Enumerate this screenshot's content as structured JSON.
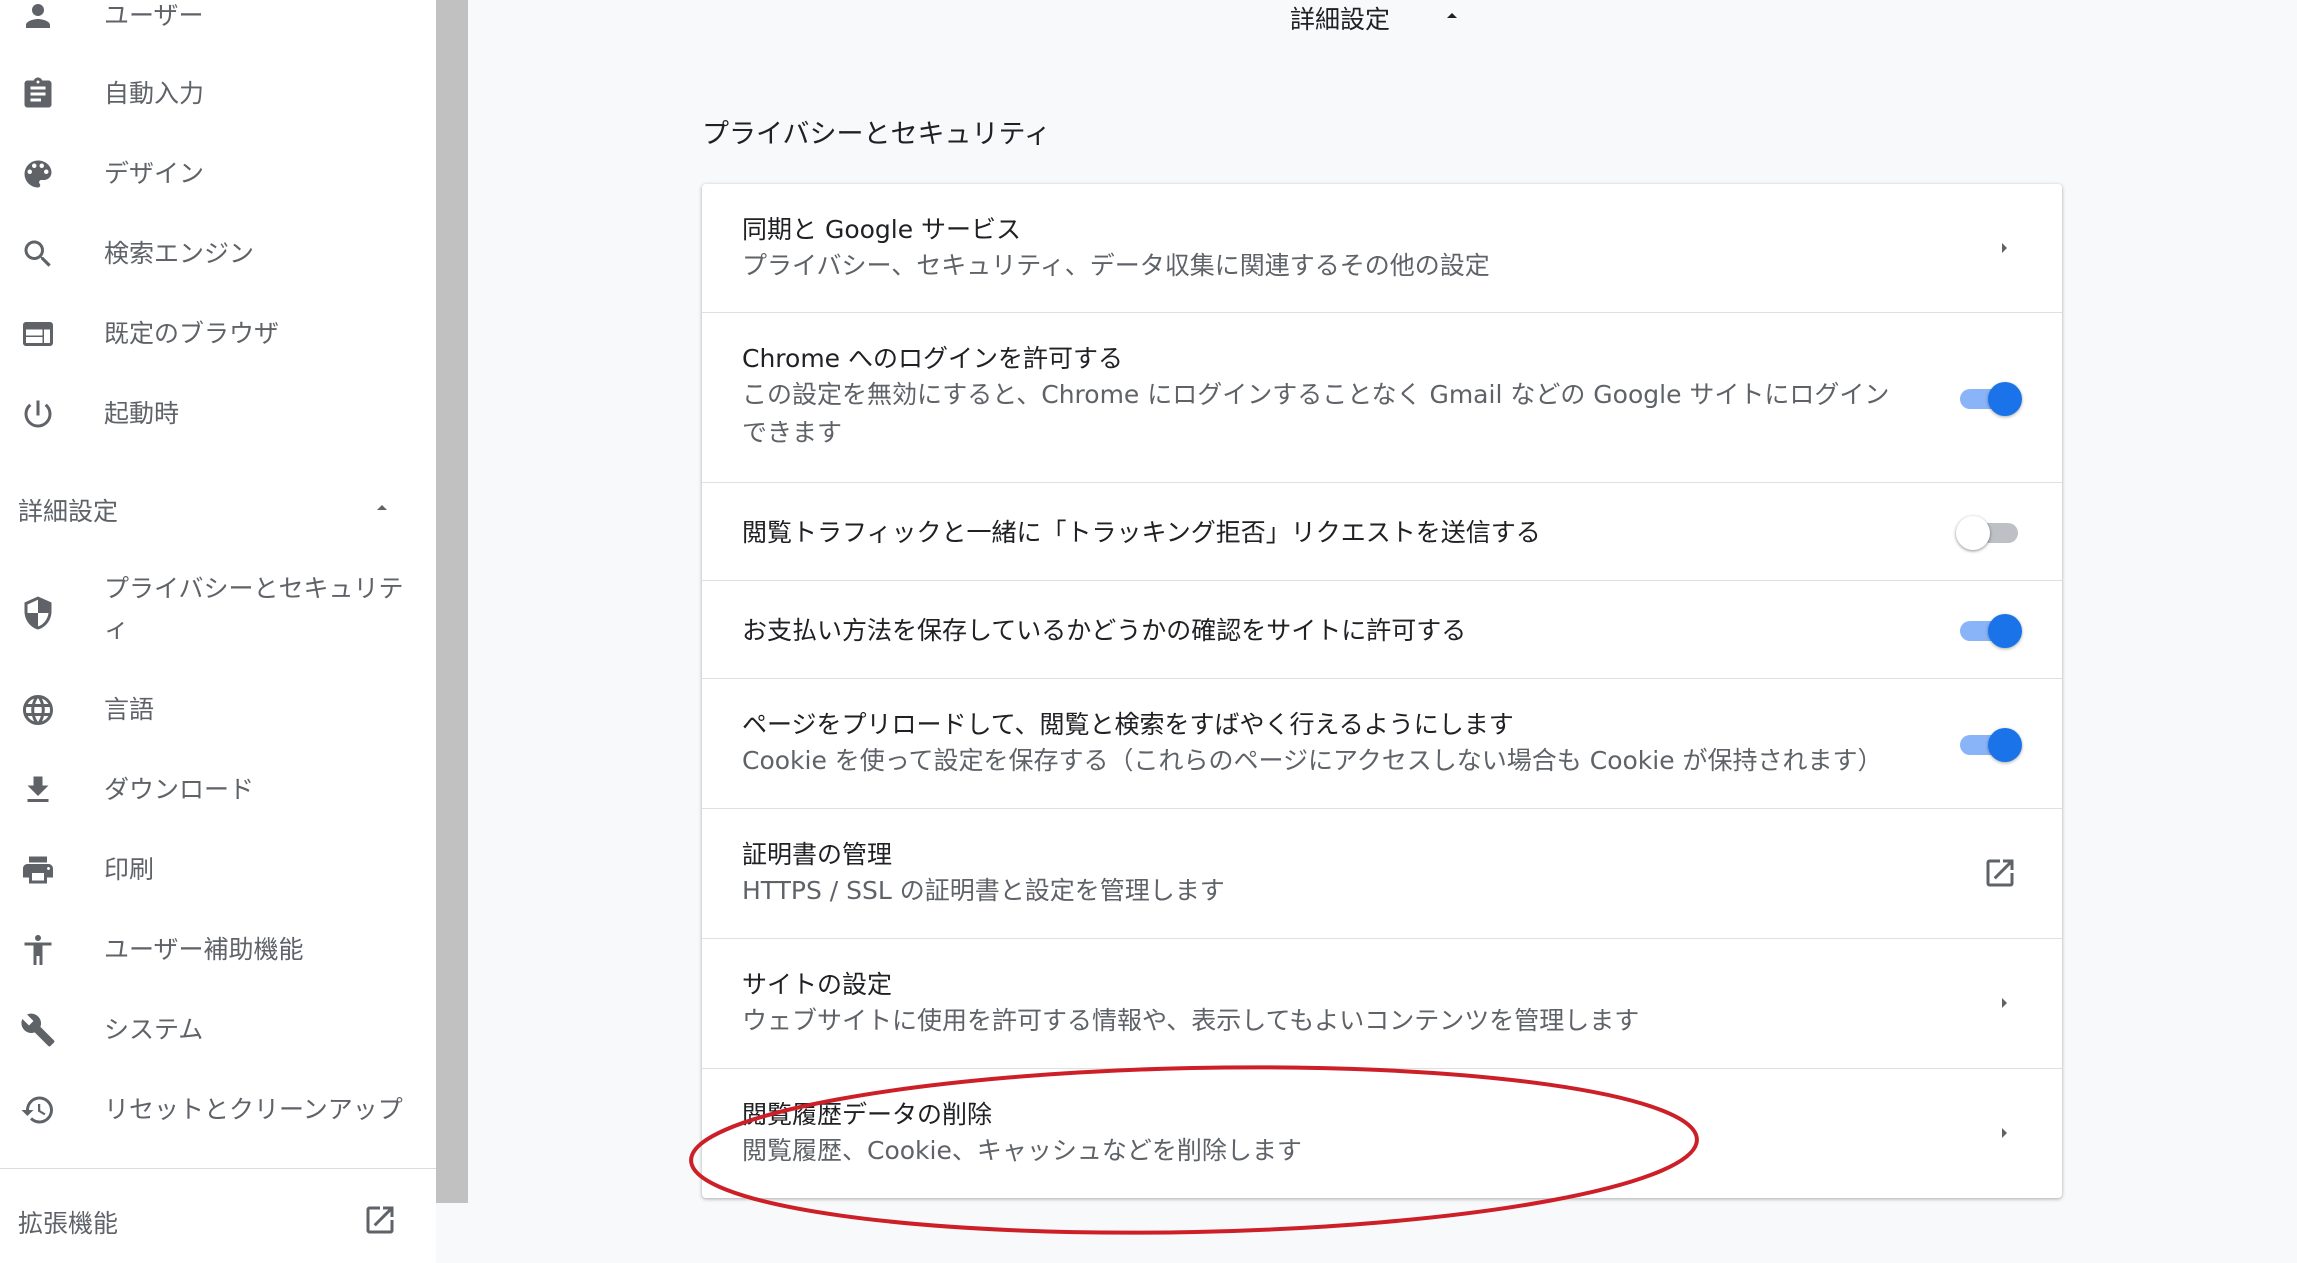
{
  "sidebar": {
    "items": [
      {
        "label": "ユーザー",
        "icon": "person-icon"
      },
      {
        "label": "自動入力",
        "icon": "clipboard-icon"
      },
      {
        "label": "デザイン",
        "icon": "palette-icon"
      },
      {
        "label": "検索エンジン",
        "icon": "search-icon"
      },
      {
        "label": "既定のブラウザ",
        "icon": "browser-window-icon"
      },
      {
        "label": "起動時",
        "icon": "power-icon"
      }
    ],
    "advanced_label": "詳細設定",
    "advanced_items": [
      {
        "label_line1": "プライバシーとセキュリテ",
        "label_line2": "ィ",
        "icon": "shield-icon"
      },
      {
        "label": "言語",
        "icon": "globe-icon"
      },
      {
        "label": "ダウンロード",
        "icon": "download-icon"
      },
      {
        "label": "印刷",
        "icon": "printer-icon"
      },
      {
        "label": "ユーザー補助機能",
        "icon": "accessibility-icon"
      },
      {
        "label": "システム",
        "icon": "wrench-icon"
      },
      {
        "label": "リセットとクリーンアップ",
        "icon": "history-icon"
      }
    ],
    "extensions_label": "拡張機能"
  },
  "main": {
    "advanced_header": "詳細設定",
    "section_title": "プライバシーとセキュリティ",
    "rows": [
      {
        "title": "同期と Google サービス",
        "subtitle": "プライバシー、セキュリティ、データ収集に関連するその他の設定",
        "control": "arrow"
      },
      {
        "title": "Chrome へのログインを許可する",
        "subtitle_line1": "この設定を無効にすると、Chrome にログインすることなく Gmail などの Google サイトにログイン",
        "subtitle_line2": "できます",
        "control": "toggle",
        "toggle_on": true
      },
      {
        "title": "閲覧トラフィックと一緒に「トラッキング拒否」リクエストを送信する",
        "control": "toggle",
        "toggle_on": false
      },
      {
        "title": "お支払い方法を保存しているかどうかの確認をサイトに許可する",
        "control": "toggle",
        "toggle_on": true
      },
      {
        "title": "ページをプリロードして、閲覧と検索をすばやく行えるようにします",
        "subtitle": "Cookie を使って設定を保存する（これらのページにアクセスしない場合も Cookie が保持されます）",
        "control": "toggle",
        "toggle_on": true
      },
      {
        "title": "証明書の管理",
        "subtitle": "HTTPS / SSL の証明書と設定を管理します",
        "control": "external-link"
      },
      {
        "title": "サイトの設定",
        "subtitle": "ウェブサイトに使用を許可する情報や、表示してもよいコンテンツを管理します",
        "control": "arrow"
      },
      {
        "title": "閲覧履歴データの削除",
        "subtitle": "閲覧履歴、Cookie、キャッシュなどを削除します",
        "control": "arrow"
      }
    ]
  },
  "colors": {
    "accent": "#1a73e8",
    "toggle_track_on": "#8ab4f8",
    "annotation": "#cc1f27"
  }
}
